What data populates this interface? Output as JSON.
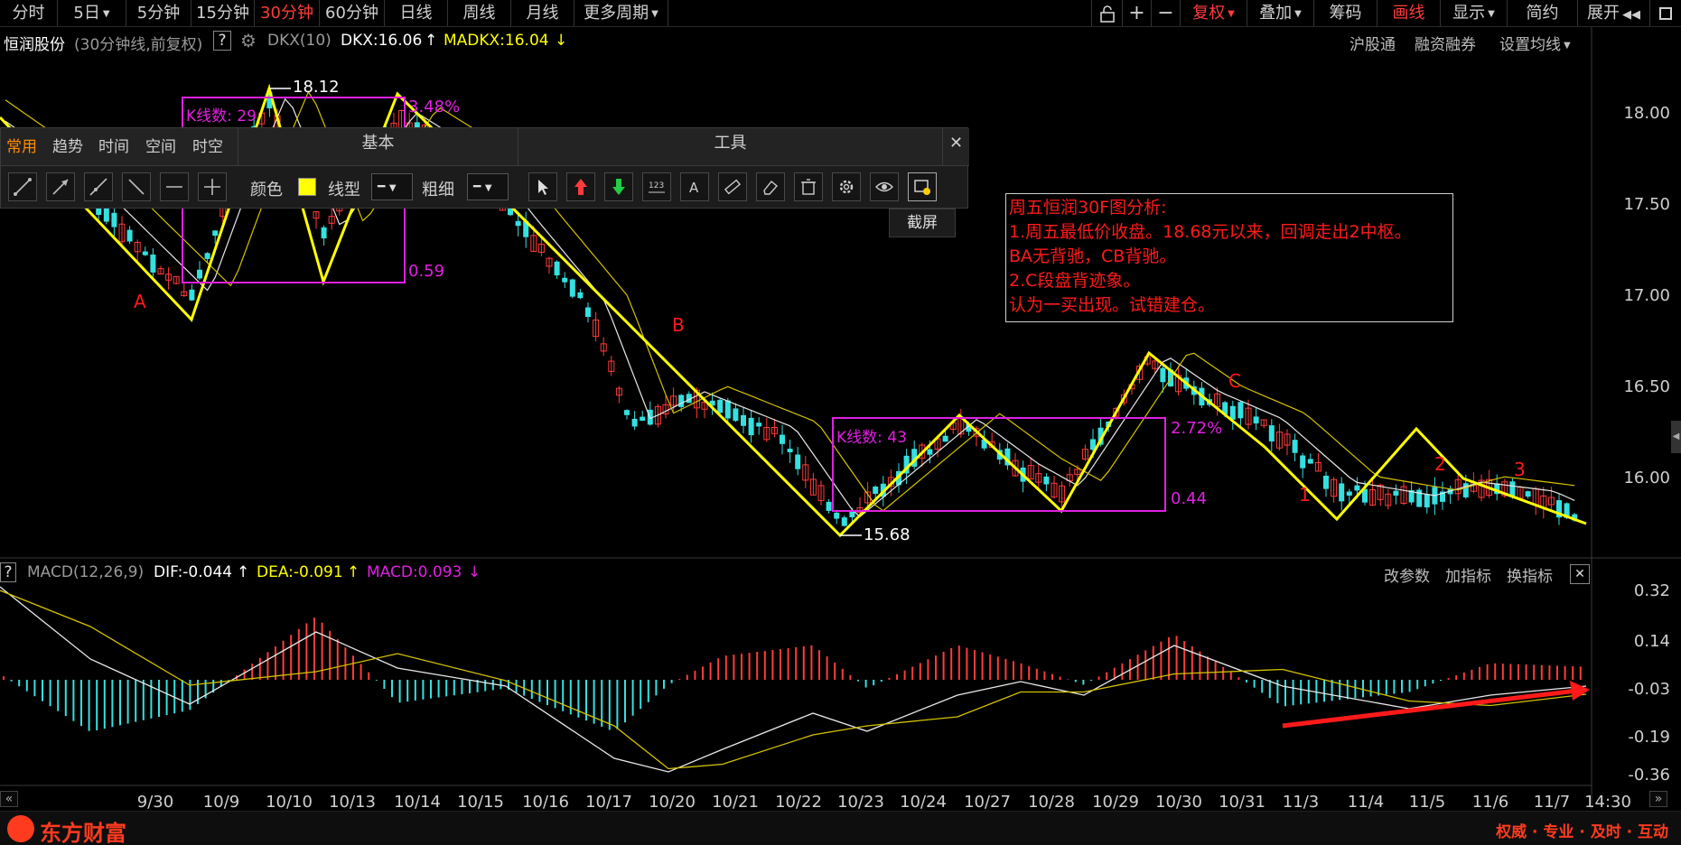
{
  "period_tabs": [
    {
      "label": "分时",
      "active": false
    },
    {
      "label": "5日",
      "active": false,
      "dropdown": true
    },
    {
      "label": "5分钟",
      "active": false
    },
    {
      "label": "15分钟",
      "active": false
    },
    {
      "label": "30分钟",
      "active": true
    },
    {
      "label": "60分钟",
      "active": false
    },
    {
      "label": "日线",
      "active": false
    },
    {
      "label": "周线",
      "active": false
    },
    {
      "label": "月线",
      "active": false
    },
    {
      "label": "更多周期",
      "active": false,
      "dropdown": true
    }
  ],
  "toolbar_right": {
    "lock_icon": "lock-icon",
    "plus_label": "+",
    "minus_label": "−",
    "fuquan": "复权",
    "diejia": "叠加",
    "choumou": "筹码",
    "huaxian": "画线",
    "xianshi": "显示",
    "jianyue": "简约",
    "zhankai": "展开"
  },
  "info": {
    "stock_name": "恒润股份",
    "mode": "(30分钟线,前复权)",
    "help": "?",
    "indicator": "DKX(10)",
    "dkx": "DKX:16.06",
    "dkx_arrow": "↑",
    "madkx": "MADKX:16.04",
    "madkx_arrow": "↓"
  },
  "header_links": {
    "hgt": "沪股通",
    "rzrq": "融资融券",
    "ma_setting": "设置均线"
  },
  "price_axis": [
    "18.00",
    "17.50",
    "17.00",
    "16.50",
    "16.00"
  ],
  "macd_axis": [
    "0.32",
    "0.14",
    "-0.03",
    "-0.19",
    "-0.36"
  ],
  "date_axis": [
    "9/30",
    "10/9",
    "10/10",
    "10/13",
    "10/14",
    "10/15",
    "10/16",
    "10/17",
    "10/20",
    "10/21",
    "10/22",
    "10/23",
    "10/24",
    "10/27",
    "10/28",
    "10/29",
    "10/30",
    "10/31",
    "11/3",
    "11/4",
    "11/5",
    "11/6",
    "11/7",
    "14:30"
  ],
  "macd_header": {
    "help": "?",
    "name": "MACD(12,26,9)",
    "dif": "DIF:-0.044",
    "dif_arrow": "↑",
    "dea": "DEA:-0.091",
    "dea_arrow": "↑",
    "macd": "MACD:0.093",
    "macd_arrow": "↓",
    "gaicanshu": "改参数",
    "jiazhibiao": "加指标",
    "huanzhibiao": "换指标",
    "close": "✕"
  },
  "draw_toolbar": {
    "tabs": [
      {
        "label": "常用",
        "active": true
      },
      {
        "label": "趋势",
        "active": false
      },
      {
        "label": "时间",
        "active": false
      },
      {
        "label": "空间",
        "active": false
      },
      {
        "label": "时空",
        "active": false
      }
    ],
    "section_basic": "基本",
    "section_tools": "工具",
    "color_label": "颜色",
    "line_type_label": "线型",
    "thickness_label": "粗细",
    "color_value": "#ffff00",
    "close": "✕",
    "tooltip": "截屏"
  },
  "annotations": {
    "high": "18.12",
    "low": "15.68",
    "box1_count": "K线数: 29",
    "box1_pct": "3.48%",
    "box1_range": "0.59",
    "box2_count": "K线数: 43",
    "box2_pct": "2.72%",
    "box2_range": "0.44",
    "label_a": "A",
    "label_b": "B",
    "label_c": "C",
    "label_1": "1",
    "label_2": "2",
    "label_3": "3"
  },
  "analysis": [
    "周五恒润30F图分析:",
    "1.周五最低价收盘。18.68元以来，回调走出2中枢。",
    "BA无背驰，CB背驰。",
    "2.C段盘背迹象。",
    "认为一买出现。试错建仓。"
  ],
  "footer": {
    "brand": "东方财富",
    "slogan": "权威 · 专业 · 及时 · 互动"
  },
  "colors": {
    "up": "#ff3b3b",
    "down": "#35e0e0",
    "yellow": "#ffff00",
    "magenta": "#e020e0",
    "annot_red": "#ff1a1a"
  }
}
